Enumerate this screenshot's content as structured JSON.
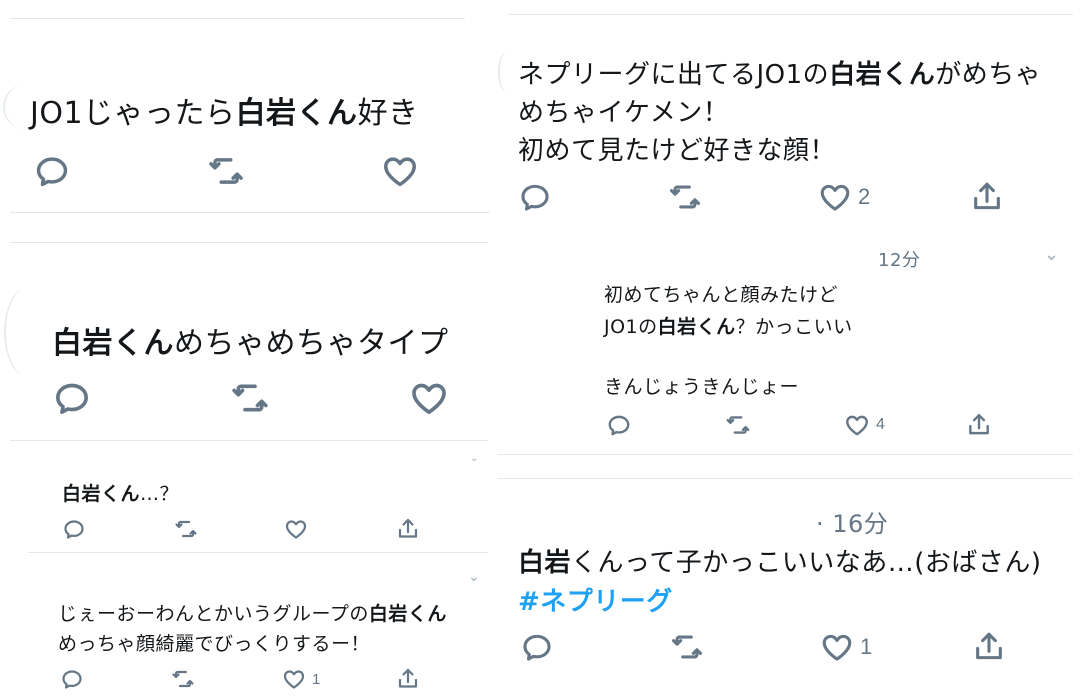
{
  "tweets": {
    "t1": {
      "text_pre": "JO1じゃったら",
      "text_bold": "白岩くん",
      "text_post": "好き"
    },
    "t2": {
      "text_bold": "白岩くん",
      "text_post": "めちゃめちゃタイプ"
    },
    "t3": {
      "text_bold": "白岩くん",
      "text_post": "…？"
    },
    "t4": {
      "line1_pre": "じぇーおーわんとかいうグループの",
      "line1_bold": "白岩くん",
      "line2": "めっちゃ顔綺麗でびっくりするー！",
      "like_count": "1"
    },
    "t5": {
      "line1_pre": "ネプリーグに出てるJO1の",
      "line1_bold": "白岩くん",
      "line1_post": "がめちゃ",
      "line2": "めちゃイケメン！",
      "line3": "初めて見たけど好きな顔！",
      "like_count": "2"
    },
    "t6": {
      "time": "12分",
      "line1": "初めてちゃんと顔みたけど",
      "line2_pre": "JO1の",
      "line2_bold": "白岩くん",
      "line2_post": "？かっこいい",
      "line3": "きんじょうきんじょー",
      "like_count": "4"
    },
    "t7": {
      "time": "· 16分",
      "line1_bold": "白岩",
      "line1_post": "くんって子かっこいいなあ…(おばさん)",
      "hashtag": "#ネプリーグ",
      "like_count": "1"
    }
  },
  "icons": [
    "reply-icon",
    "retweet-icon",
    "like-icon",
    "share-icon",
    "chevron-down-icon"
  ],
  "colors": {
    "text": "#14171a",
    "icon": "#657786",
    "hashtag": "#1da1f2",
    "divider": "#e1e8ed"
  }
}
